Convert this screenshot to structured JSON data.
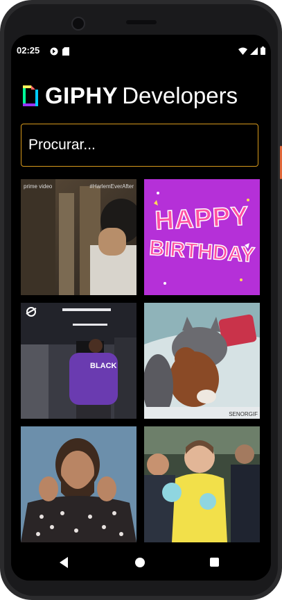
{
  "status_bar": {
    "time": "02:25",
    "icons": [
      "app-notification-icon",
      "sd-card-icon",
      "wifi-icon",
      "cellular-icon",
      "battery-icon"
    ]
  },
  "header": {
    "brand": "GIPHY",
    "subtitle": "Developers"
  },
  "search": {
    "placeholder": "Procurar..."
  },
  "gifs": [
    {
      "id": "gif-1",
      "subject": "prime-video-clip",
      "overlay_left": "prime video",
      "overlay_right": "#HarlemEverAfter"
    },
    {
      "id": "gif-2",
      "subject": "happy-birthday",
      "text_line1": "HAPPY",
      "text_line2": "BIRTHDAY"
    },
    {
      "id": "gif-3",
      "subject": "basketball-player-walking",
      "shirt_text": "BLACK"
    },
    {
      "id": "gif-4",
      "subject": "cat-with-teddy-bear",
      "watermark": "SENORGIF"
    },
    {
      "id": "gif-5",
      "subject": "man-posing"
    },
    {
      "id": "gif-6",
      "subject": "girl-with-cotton-candy"
    }
  ],
  "colors": {
    "search_border": "#d89a1c",
    "birthday_bg": "#b530d8",
    "birthday_text": "#ff4fa0"
  },
  "nav": {
    "back": "back-icon",
    "home": "home-icon",
    "recents": "recents-icon"
  }
}
